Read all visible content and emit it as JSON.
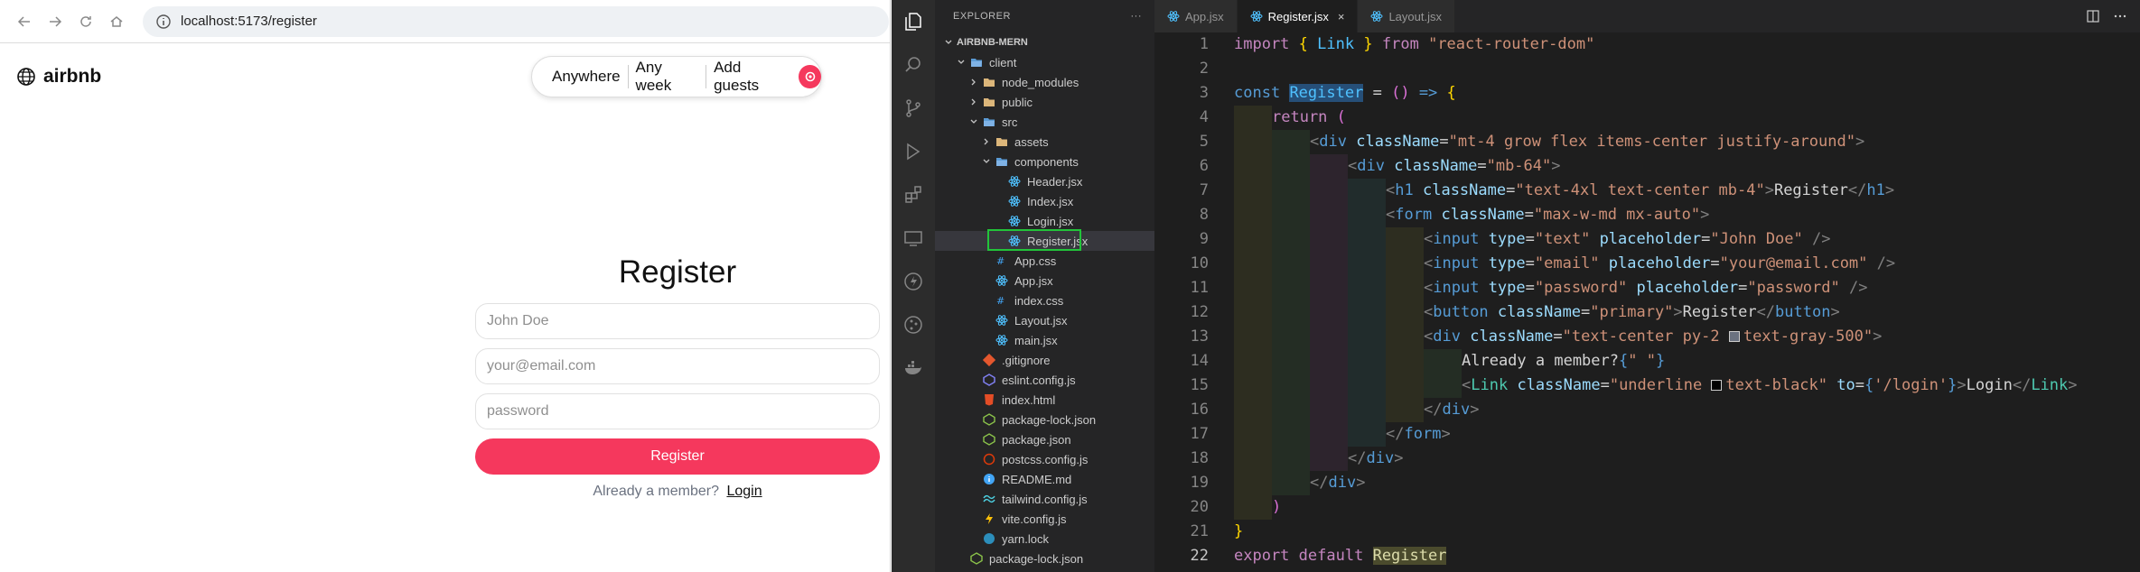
{
  "browser": {
    "url": "localhost:5173/register",
    "site": {
      "logo_text": "airbnb",
      "search": {
        "anywhere": "Anywhere",
        "any_week": "Any week",
        "add_guests": "Add guests"
      },
      "register": {
        "title": "Register",
        "name_placeholder": "John Doe",
        "email_placeholder": "your@email.com",
        "password_placeholder": "password",
        "submit_label": "Register",
        "member_text": "Already a member?",
        "login_link": "Login"
      },
      "accent_color": "#f5385d"
    }
  },
  "vscode": {
    "explorer": {
      "header": "EXPLORER",
      "more": "···",
      "root": "AIRBNB-MERN",
      "items": [
        {
          "label": "client",
          "icon": "folder-open-icon",
          "indent": 1,
          "chevron": "down"
        },
        {
          "label": "node_modules",
          "icon": "folder-icon",
          "indent": 2,
          "chevron": "right"
        },
        {
          "label": "public",
          "icon": "folder-icon",
          "indent": 2,
          "chevron": "right"
        },
        {
          "label": "src",
          "icon": "folder-open-icon",
          "indent": 2,
          "chevron": "down"
        },
        {
          "label": "assets",
          "icon": "folder-icon",
          "indent": 3,
          "chevron": "right"
        },
        {
          "label": "components",
          "icon": "folder-open-icon",
          "indent": 3,
          "chevron": "down"
        },
        {
          "label": "Header.jsx",
          "icon": "react-icon",
          "indent": 4,
          "chevron": ""
        },
        {
          "label": "Index.jsx",
          "icon": "react-icon",
          "indent": 4,
          "chevron": ""
        },
        {
          "label": "Login.jsx",
          "icon": "react-icon",
          "indent": 4,
          "chevron": ""
        },
        {
          "label": "Register.jsx",
          "icon": "react-icon",
          "indent": 4,
          "chevron": "",
          "selected": true
        },
        {
          "label": "App.css",
          "icon": "css-icon",
          "indent": 3,
          "chevron": ""
        },
        {
          "label": "App.jsx",
          "icon": "react-icon",
          "indent": 3,
          "chevron": ""
        },
        {
          "label": "index.css",
          "icon": "css-icon",
          "indent": 3,
          "chevron": ""
        },
        {
          "label": "Layout.jsx",
          "icon": "react-icon",
          "indent": 3,
          "chevron": ""
        },
        {
          "label": "main.jsx",
          "icon": "react-icon",
          "indent": 3,
          "chevron": ""
        },
        {
          "label": ".gitignore",
          "icon": "git-icon",
          "indent": 2,
          "chevron": ""
        },
        {
          "label": "eslint.config.js",
          "icon": "eslint-icon",
          "indent": 2,
          "chevron": ""
        },
        {
          "label": "index.html",
          "icon": "html-icon",
          "indent": 2,
          "chevron": ""
        },
        {
          "label": "package-lock.json",
          "icon": "node-icon",
          "indent": 2,
          "chevron": ""
        },
        {
          "label": "package.json",
          "icon": "node-icon",
          "indent": 2,
          "chevron": ""
        },
        {
          "label": "postcss.config.js",
          "icon": "postcss-icon",
          "indent": 2,
          "chevron": ""
        },
        {
          "label": "README.md",
          "icon": "info-icon",
          "indent": 2,
          "chevron": ""
        },
        {
          "label": "tailwind.config.js",
          "icon": "tailwind-icon",
          "indent": 2,
          "chevron": ""
        },
        {
          "label": "vite.config.js",
          "icon": "vite-icon",
          "indent": 2,
          "chevron": ""
        },
        {
          "label": "yarn.lock",
          "icon": "yarn-icon",
          "indent": 2,
          "chevron": ""
        },
        {
          "label": "package-lock.json",
          "icon": "node-icon",
          "indent": 1,
          "chevron": ""
        }
      ]
    },
    "tabs": [
      {
        "label": "App.jsx",
        "active": false
      },
      {
        "label": "Register.jsx",
        "active": true,
        "close": "×"
      },
      {
        "label": "Layout.jsx",
        "active": false
      }
    ],
    "editor": {
      "line_numbers": [
        "1",
        "2",
        "3",
        "4",
        "5",
        "6",
        "7",
        "8",
        "9",
        "10",
        "11",
        "12",
        "13",
        "14",
        "15",
        "16",
        "17",
        "18",
        "19",
        "20",
        "21",
        "22"
      ],
      "current_line": "22",
      "tokens": {
        "l1": [
          "import",
          "{",
          "Link",
          "}",
          "from",
          "\"react-router-dom\""
        ],
        "l3": [
          "const",
          "Register",
          "=",
          "()",
          "=>",
          "{"
        ],
        "l4": [
          "return",
          "("
        ],
        "l5": [
          "<",
          "div",
          "className",
          "=",
          "\"mt-4 grow flex items-center justify-around\"",
          ">"
        ],
        "l6": [
          "<",
          "div",
          "className",
          "=",
          "\"mb-64\"",
          ">"
        ],
        "l7": [
          "<",
          "h1",
          "className",
          "=",
          "\"text-4xl text-center mb-4\"",
          ">",
          "Register",
          "</",
          "h1",
          ">"
        ],
        "l8": [
          "<",
          "form",
          "className",
          "=",
          "\"max-w-md mx-auto\"",
          ">"
        ],
        "l9": [
          "<",
          "input",
          "type",
          "=",
          "\"text\"",
          "placeholder",
          "=",
          "\"John Doe\"",
          "/>"
        ],
        "l10": [
          "<",
          "input",
          "type",
          "=",
          "\"email\"",
          "placeholder",
          "=",
          "\"your@email.com\"",
          "/>"
        ],
        "l11": [
          "<",
          "input",
          "type",
          "=",
          "\"password\"",
          "placeholder",
          "=",
          "\"password\"",
          "/>"
        ],
        "l12": [
          "<",
          "button",
          "className",
          "=",
          "\"primary\"",
          ">",
          "Register",
          "</",
          "button",
          ">"
        ],
        "l13": [
          "<",
          "div",
          "className",
          "=",
          "\"text-center py-2 ",
          "text-gray-500\"",
          ">"
        ],
        "l14": [
          "Already a member?",
          "{",
          "\" \"",
          "}"
        ],
        "l15": [
          "<",
          "Link",
          "className",
          "=",
          "\"underline ",
          "text-black\"",
          "to",
          "=",
          "{",
          "'/login'",
          "}",
          ">",
          "Login",
          "</",
          "Link",
          ">"
        ],
        "l16": [
          "</",
          "div",
          ">"
        ],
        "l17": [
          "</",
          "form",
          ">"
        ],
        "l18": [
          "</",
          "div",
          ">"
        ],
        "l19": [
          "</",
          "div",
          ">"
        ],
        "l20": [
          ")"
        ],
        "l21": [
          "}"
        ],
        "l22": [
          "export",
          "default",
          "Register"
        ]
      }
    }
  }
}
